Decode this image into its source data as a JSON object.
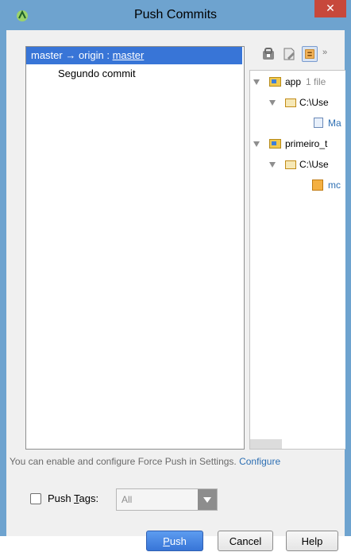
{
  "window": {
    "title": "Push Commits",
    "close_glyph": "✕"
  },
  "commits_tree": {
    "branch_prefix": "master → origin : ",
    "branch_target": "master",
    "commits": [
      "Segundo commit"
    ]
  },
  "toolbar_icons": [
    "vcs-icon",
    "edit-icon",
    "diff-icon"
  ],
  "changes_tree": {
    "app": {
      "name": "app",
      "meta": "1 file"
    },
    "app_path": "C:\\Use",
    "app_file": "Ma",
    "module2": {
      "name": "primeiro_t"
    },
    "module2_path": "C:\\Use",
    "module2_file": "mc"
  },
  "hint": {
    "text": "You can enable and configure Force Push in Settings.",
    "link": "Configure"
  },
  "push_tags": {
    "label_pre": "Push ",
    "label_ul": "T",
    "label_post": "ags:",
    "select_value": "All",
    "checked": false
  },
  "buttons": {
    "push_ul": "P",
    "push_rest": "ush",
    "cancel": "Cancel",
    "help": "Help"
  },
  "colors": {
    "titlebar": "#6ea3cf",
    "selection": "#3875d7",
    "close": "#c7483b"
  }
}
